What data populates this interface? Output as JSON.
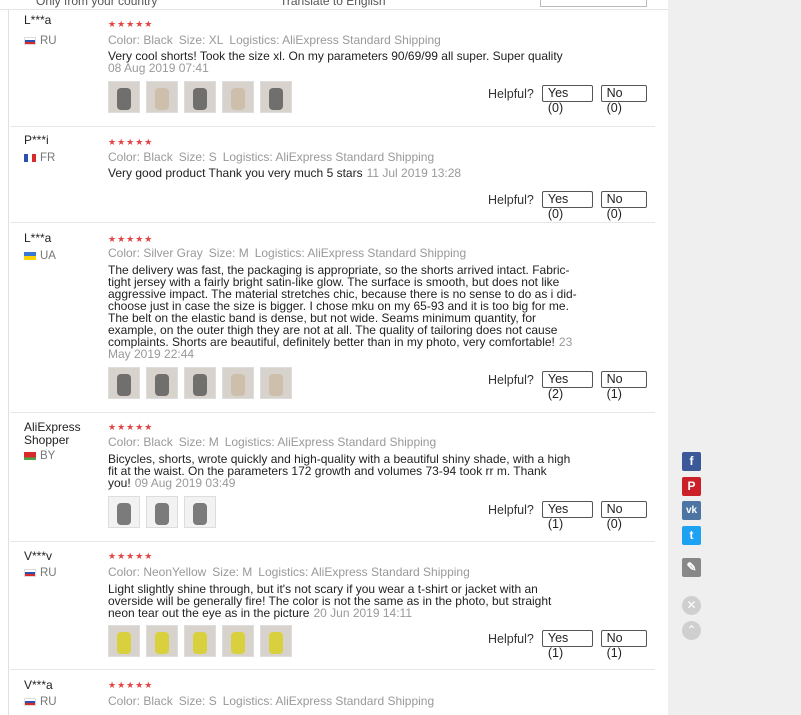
{
  "filter": {
    "checkbox_label": "Only from your country",
    "translate_label": "Translate to English"
  },
  "helpful_label": "Helpful?",
  "reviews": [
    {
      "user": "L***a",
      "country": "RU",
      "flag": "ru",
      "color": "Color: Black",
      "size": "Size: XL",
      "logistics": "Logistics: AliExpress Standard Shipping",
      "text": "Very cool shorts! Took the size xl. On my parameters 90/69/99 all super. Super quality",
      "date": "08 Aug 2019 07:41",
      "yes": "Yes (0)",
      "no": "No (0)",
      "thumbs": 5
    },
    {
      "user": "P***i",
      "country": "FR",
      "flag": "fr",
      "color": "Color: Black",
      "size": "Size: S",
      "logistics": "Logistics: AliExpress Standard Shipping",
      "text": "Very good product Thank you very much 5 stars",
      "date": "11 Jul 2019 13:28",
      "yes": "Yes (0)",
      "no": "No (0)",
      "thumbs": 0
    },
    {
      "user": "L***a",
      "country": "UA",
      "flag": "ua",
      "color": "Color: Silver Gray",
      "size": "Size: M",
      "logistics": "Logistics: AliExpress Standard Shipping",
      "text": "The delivery was fast, the packaging is appropriate, so the shorts arrived intact. Fabric-tight jersey with a fairly bright satin-like glow. The surface is smooth, but does not like aggressive impact. The material stretches chic, because there is no sense to do as i did-choose just in case the size is bigger. I chose mku on my 65-93 and it is too big for me. The belt on the elastic band is dense, but not wide. Seams minimum quantity, for example, on the outer thigh they are not at all. The quality of tailoring does not cause complaints. Shorts are beautiful, definitely better than in my photo, very comfortable!",
      "date": "23 May 2019 22:44",
      "yes": "Yes (2)",
      "no": "No (1)",
      "thumbs": 5
    },
    {
      "user": "AliExpress Shopper",
      "country": "BY",
      "flag": "by",
      "color": "Color: Black",
      "size": "Size: M",
      "logistics": "Logistics: AliExpress Standard Shipping",
      "text": "Bicycles, shorts, wrote quickly and high-quality with a beautiful shiny shade, with a high fit at the waist. On the parameters 172 growth and volumes 73-94 took rr m. Thank you!",
      "date": "09 Aug 2019 03:49",
      "yes": "Yes (1)",
      "no": "No (0)",
      "thumbs": 3
    },
    {
      "user": "V***v",
      "country": "RU",
      "flag": "ru",
      "color": "Color: NeonYellow",
      "size": "Size: M",
      "logistics": "Logistics: AliExpress Standard Shipping",
      "text": "Light slightly shine through, but it's not scary if you wear a t-shirt or jacket with an overside will be generally fire! The color is not the same as in the photo, but straight neon tear out the eye as in the picture",
      "date": "20 Jun 2019 14:11",
      "yes": "Yes (1)",
      "no": "No (1)",
      "thumbs": 5
    },
    {
      "user": "V***a",
      "country": "RU",
      "flag": "ru",
      "color": "Color: Black",
      "size": "Size: S",
      "logistics": "Logistics: AliExpress Standard Shipping",
      "text": "",
      "date": "",
      "yes": "",
      "no": "",
      "thumbs": 0
    }
  ],
  "share_icons": [
    "facebook-icon",
    "pinterest-icon",
    "vk-icon",
    "twitter-icon",
    "edit-icon"
  ],
  "share_glyphs": {
    "facebook": "f",
    "pinterest": "P",
    "vk": "vk",
    "twitter": "t",
    "edit": "✎",
    "close": "✕",
    "up": "⌃"
  },
  "colors": {
    "facebook": "#3b5998",
    "pinterest": "#cb2027",
    "vk": "#4c75a3",
    "twitter": "#1da1f2",
    "edit": "#888888",
    "stars": "#e34343"
  },
  "stars": "★★★★★"
}
